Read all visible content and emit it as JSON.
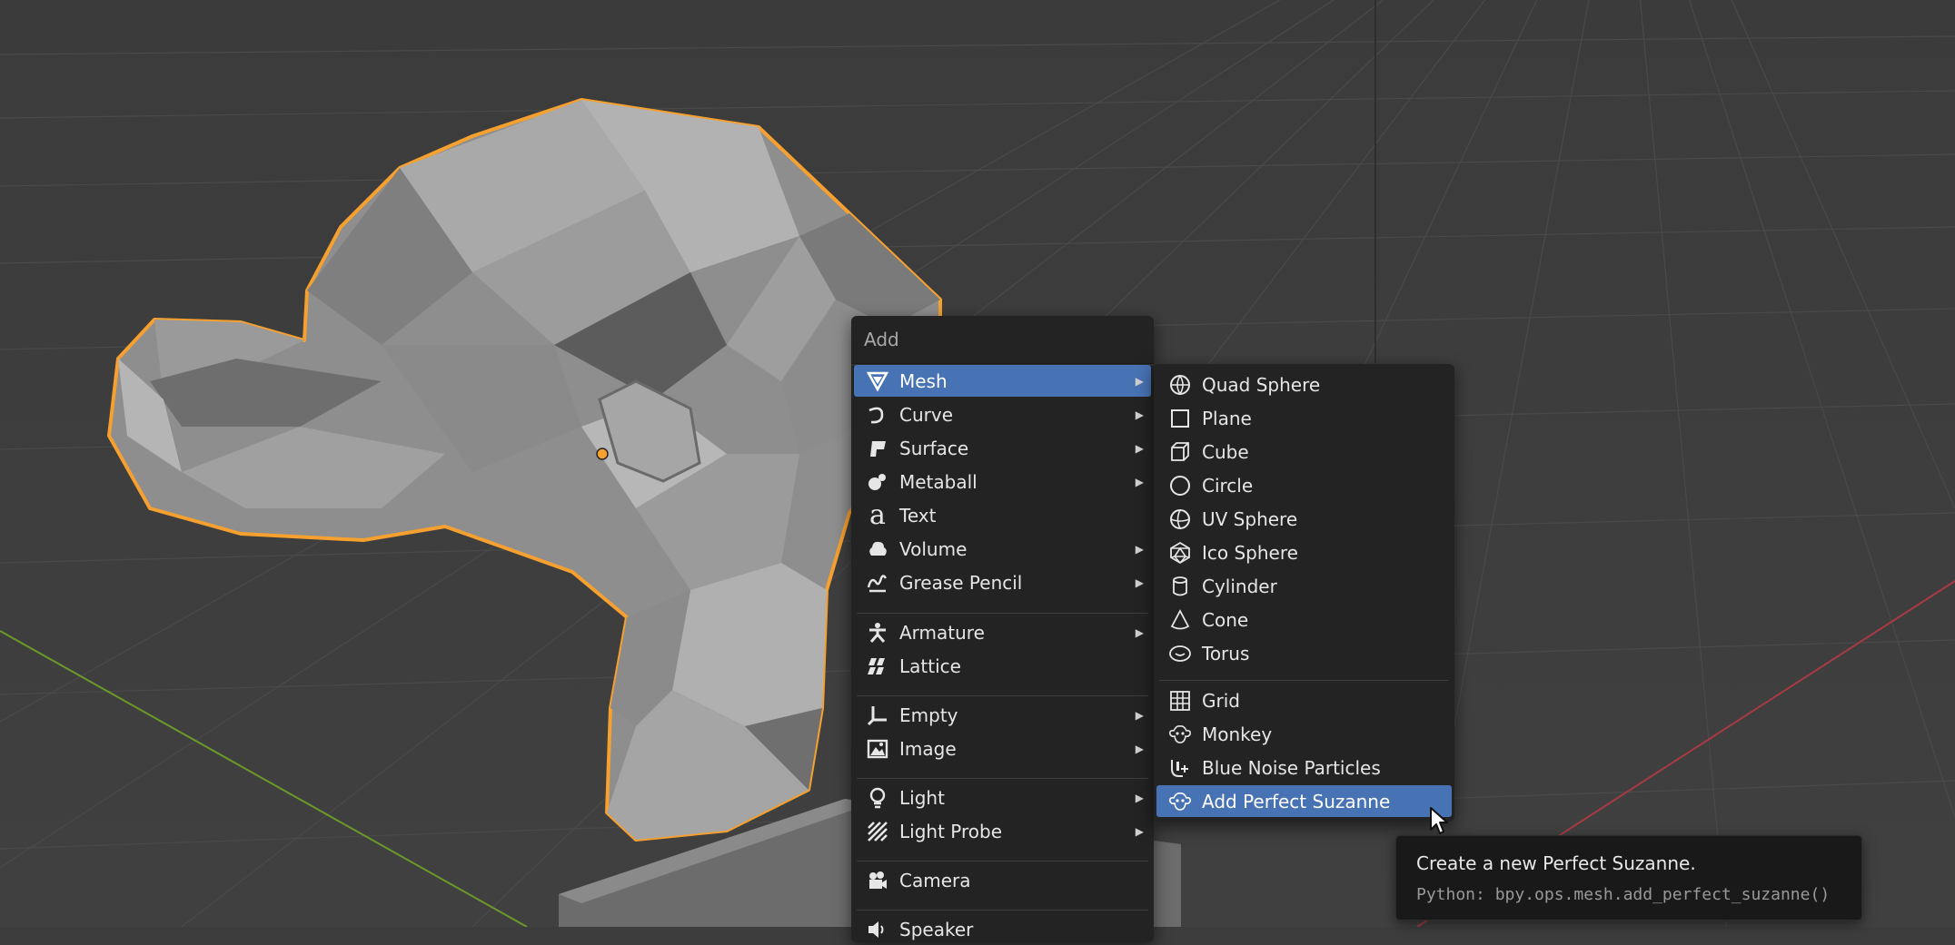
{
  "colors": {
    "viewport_bg": "#3d3d3d",
    "menu_bg": "#232323",
    "highlight": "#4772b3",
    "selection_outline": "#f5a02f",
    "axis_x": "#a83a44",
    "axis_y": "#6b9a2a"
  },
  "add_menu": {
    "title": "Add",
    "items": [
      {
        "label": "Mesh",
        "icon": "mesh-icon",
        "submenu": true,
        "active": true
      },
      {
        "label": "Curve",
        "icon": "curve-icon",
        "submenu": true
      },
      {
        "label": "Surface",
        "icon": "surface-icon",
        "submenu": true
      },
      {
        "label": "Metaball",
        "icon": "metaball-icon",
        "submenu": true
      },
      {
        "label": "Text",
        "icon": "text-icon",
        "submenu": false
      },
      {
        "label": "Volume",
        "icon": "volume-icon",
        "submenu": true
      },
      {
        "label": "Grease Pencil",
        "icon": "grease-pencil-icon",
        "submenu": true
      },
      {
        "label": "Armature",
        "icon": "armature-icon",
        "submenu": true
      },
      {
        "label": "Lattice",
        "icon": "lattice-icon",
        "submenu": false
      },
      {
        "label": "Empty",
        "icon": "empty-icon",
        "submenu": true
      },
      {
        "label": "Image",
        "icon": "image-icon",
        "submenu": true
      },
      {
        "label": "Light",
        "icon": "light-icon",
        "submenu": true
      },
      {
        "label": "Light Probe",
        "icon": "light-probe-icon",
        "submenu": true
      },
      {
        "label": "Camera",
        "icon": "camera-icon",
        "submenu": false
      },
      {
        "label": "Speaker",
        "icon": "speaker-icon",
        "submenu": false
      }
    ]
  },
  "mesh_menu": {
    "items": [
      {
        "label": "Quad Sphere",
        "icon": "quad-sphere-icon"
      },
      {
        "label": "Plane",
        "icon": "plane-icon"
      },
      {
        "label": "Cube",
        "icon": "cube-icon"
      },
      {
        "label": "Circle",
        "icon": "circle-icon"
      },
      {
        "label": "UV Sphere",
        "icon": "uv-sphere-icon"
      },
      {
        "label": "Ico Sphere",
        "icon": "ico-sphere-icon"
      },
      {
        "label": "Cylinder",
        "icon": "cylinder-icon"
      },
      {
        "label": "Cone",
        "icon": "cone-icon"
      },
      {
        "label": "Torus",
        "icon": "torus-icon"
      },
      {
        "label": "Grid",
        "icon": "grid-icon"
      },
      {
        "label": "Monkey",
        "icon": "monkey-icon"
      },
      {
        "label": "Blue Noise Particles",
        "icon": "blue-noise-particles-icon"
      },
      {
        "label": "Add Perfect Suzanne",
        "icon": "monkey-icon",
        "active": true
      }
    ]
  },
  "tooltip": {
    "description": "Create a new Perfect Suzanne.",
    "python": "Python: bpy.ops.mesh.add_perfect_suzanne()"
  }
}
